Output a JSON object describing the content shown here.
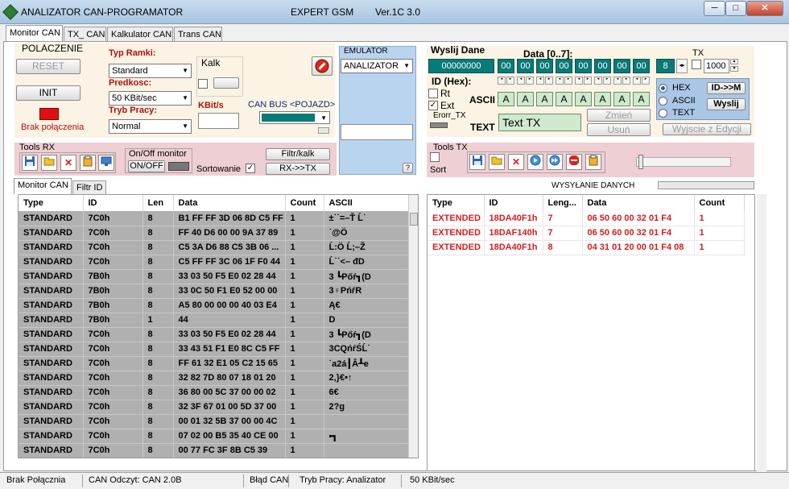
{
  "window": {
    "title": "ANALIZATOR CAN-PROGRAMATOR",
    "title_center": "EXPERT GSM",
    "version": "Ver.1C 3.0",
    "minimize": "─",
    "maximize": "□",
    "close": "✕"
  },
  "tabs": [
    {
      "label": "Monitor CAN"
    },
    {
      "label": "TX_ CAN"
    },
    {
      "label": "Kalkulator CAN"
    },
    {
      "label": "Trans CAN"
    }
  ],
  "connection": {
    "title": "POLACZENIE",
    "reset": "RESET",
    "init": "INIT",
    "status": "Brak połączenia"
  },
  "frame_settings": {
    "typ_ramki_label": "Typ Ramki:",
    "typ_ramki_value": "Standard",
    "predkosc_label": "Predkosc:",
    "predkosc_value": "50 KBit/sec",
    "tryb_label": "Tryb Pracy:",
    "tryb_value": "Normal",
    "kalk_label": "Kalk",
    "kbits_label": "KBit/s",
    "canbus_label": "CAN BUS <POJAZD>"
  },
  "emulator": {
    "title": "EMULATOR",
    "value": "ANALIZATOR",
    "help": "?"
  },
  "send": {
    "title": "Wyslij Dane",
    "data_label": "Data [0..7]:",
    "id_label": "ID (Hex):",
    "id_value": "00000000",
    "bytes": [
      "00",
      "00",
      "00",
      "00",
      "00",
      "00",
      "00",
      "00"
    ],
    "dlc": "8",
    "tx_label": "TX",
    "tx_value": "1000",
    "rt_label": "Rt",
    "ext_label": "Ext",
    "error_label": "Erorr_TX",
    "ascii_label": "ASCII",
    "ascii_values": [
      "A",
      "A",
      "A",
      "A",
      "A",
      "A",
      "A",
      "A"
    ],
    "text_label": "TEXT",
    "text_value": "Text TX",
    "zmien": "Zmień",
    "usun": "Usuń",
    "wyjscie": "Wyjscie z Edycji",
    "modes": [
      "HEX",
      "ASCII",
      "TEXT"
    ],
    "id_m": "ID->>M",
    "wyslij": "Wyslij"
  },
  "tools_rx": {
    "title": "Tools RX",
    "onoff_title": "On/Off monitor",
    "onoff": "ON/OFF",
    "filtr": "Filtr/kalk",
    "rx_tx": "RX->>TX",
    "sort": "Sortowanie"
  },
  "tools_tx": {
    "title": "Tools TX",
    "sort": "Sort",
    "sending": "WYSYŁANIE DANYCH"
  },
  "subtabs": [
    {
      "label": "Monitor CAN"
    },
    {
      "label": "Filtr ID"
    }
  ],
  "rx_table": {
    "headers": [
      "Type",
      "ID",
      "Len",
      "Data",
      "Count",
      "ASCII"
    ],
    "rows": [
      [
        "STANDARD",
        "7C0h",
        "8",
        "B1 FF FF 3D 06 8D C5 FF",
        "1",
        "±˙˙=–Ť Ĺ˙"
      ],
      [
        "STANDARD",
        "7C0h",
        "8",
        "FF 40 D6 00 00 9A 37 89",
        "1",
        "˙@Ö"
      ],
      [
        "STANDARD",
        "7C0h",
        "8",
        "C5 3A D6 88 C5 3B 06 ...",
        "1",
        "Ĺ:Ö Ĺ;–Ž"
      ],
      [
        "STANDARD",
        "7C0h",
        "8",
        "C5 FF FF 3C 06 1F F0 44",
        "1",
        "Ĺ˙˙<– đD"
      ],
      [
        "STANDARD",
        "7B0h",
        "8",
        "33 03 50 F5 E0 02 28 44",
        "1",
        "3 ┗Pőŕ┓(D"
      ],
      [
        "STANDARD",
        "7B0h",
        "8",
        "33 0C 50 F1 E0 52 00 00",
        "1",
        "3♀PńŕR"
      ],
      [
        "STANDARD",
        "7B0h",
        "8",
        "A5 80 00 00 00 40 03 E4",
        "1",
        "Ą€"
      ],
      [
        "STANDARD",
        "7B0h",
        "1",
        "44",
        "1",
        "D"
      ],
      [
        "STANDARD",
        "7C0h",
        "8",
        "33 03 50 F5 E0 02 28 44",
        "1",
        "3 ┗Pőŕ┓(D"
      ],
      [
        "STANDARD",
        "7C0h",
        "8",
        "33 43 51 F1 E0 8C C5 FF",
        "1",
        "3CQńŕŚĹ˙"
      ],
      [
        "STANDARD",
        "7C0h",
        "8",
        "FF 61 32 E1 05 C2 15 65",
        "1",
        "˙a2á┃Â┸e"
      ],
      [
        "STANDARD",
        "7C0h",
        "8",
        "32 82 7D 80 07 18 01 20",
        "1",
        "2‚}€•↑"
      ],
      [
        "STANDARD",
        "7C0h",
        "8",
        "36 80 00 5C 37 00 00 02",
        "1",
        "6€"
      ],
      [
        "STANDARD",
        "7C0h",
        "8",
        "32 3F 67 01 00 5D 37 00",
        "1",
        "2?g"
      ],
      [
        "STANDARD",
        "7C0h",
        "8",
        "00 01 32 5B 37 00 00 4C",
        "1",
        ""
      ],
      [
        "STANDARD",
        "7C0h",
        "8",
        "07 02 00 B5 35 40 CE 00",
        "1",
        "•┓"
      ],
      [
        "STANDARD",
        "7C0h",
        "8",
        "00 77 FC 3F 8B C5 39",
        "1",
        ""
      ]
    ]
  },
  "tx_table": {
    "headers": [
      "Type",
      "ID",
      "Leng...",
      "Data",
      "Count"
    ],
    "rows": [
      [
        "EXTENDED",
        "18DA40F1h",
        "7",
        "06 50 60 00 32 01 F4",
        "1"
      ],
      [
        "EXTENDED",
        "18DAF140h",
        "7",
        "06 50 60 00 32 01 F4",
        "1"
      ],
      [
        "EXTENDED",
        "18DA40F1h",
        "8",
        "04 31 01 20 00 01 F4 08",
        "1"
      ]
    ]
  },
  "status": {
    "connection": "Brak Połącznia",
    "can_read": "CAN Odczyt: CAN 2.0B",
    "error": "Błąd CAN",
    "mode": "Tryb Pracy: Analizator",
    "speed": "50 KBit/sec"
  },
  "colors": {
    "accent_teal": "#087a78",
    "status_red": "#e01010",
    "tx_text": "#d02020"
  }
}
